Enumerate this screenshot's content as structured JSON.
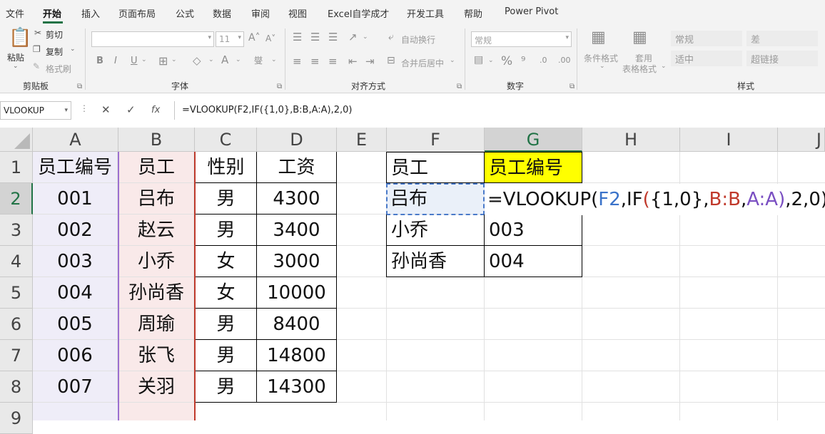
{
  "menu": {
    "tabs": [
      "文件",
      "开始",
      "插入",
      "页面布局",
      "公式",
      "数据",
      "审阅",
      "视图",
      "Excel自学成才",
      "开发工具",
      "帮助",
      "Power Pivot"
    ],
    "active": "开始"
  },
  "ribbon": {
    "clipboard": {
      "paste": "粘贴",
      "cut": "剪切",
      "copy": "复制",
      "format_painter": "格式刷",
      "label": "剪贴板"
    },
    "font": {
      "size": "11",
      "label": "字体",
      "bold": "B",
      "italic": "I",
      "underline": "U"
    },
    "alignment": {
      "wrap": "自动换行",
      "merge": "合并后居中",
      "label": "对齐方式"
    },
    "number": {
      "format": "常规",
      "label": "数字",
      "percent": "%"
    },
    "styles": {
      "conditional": "条件格式",
      "table_line1": "套用",
      "table_line2": "表格格式",
      "cells": [
        "常规",
        "差",
        "适中",
        "超链接"
      ],
      "label": "样式"
    }
  },
  "formula_bar": {
    "name_box": "VLOOKUP",
    "formula": "=VLOOKUP(F2,IF({1,0},B:B,A:A),2,0)"
  },
  "grid": {
    "columns": [
      "A",
      "B",
      "C",
      "D",
      "E",
      "F",
      "G",
      "H",
      "I",
      "J"
    ],
    "rows": [
      "1",
      "2",
      "3",
      "4",
      "5",
      "6",
      "7",
      "8",
      "9"
    ],
    "table": [
      [
        "员工编号",
        "员工",
        "性别",
        "工资"
      ],
      [
        "001",
        "吕布",
        "男",
        "4300"
      ],
      [
        "002",
        "赵云",
        "男",
        "3400"
      ],
      [
        "003",
        "小乔",
        "女",
        "3000"
      ],
      [
        "004",
        "孙尚香",
        "女",
        "10000"
      ],
      [
        "005",
        "周瑜",
        "男",
        "8400"
      ],
      [
        "006",
        "张飞",
        "男",
        "14800"
      ],
      [
        "007",
        "关羽",
        "男",
        "14300"
      ]
    ],
    "lookup": {
      "header_f": "员工",
      "header_g": "员工编号",
      "rows": [
        {
          "name": "吕布",
          "value": ""
        },
        {
          "name": "小乔",
          "value": "003"
        },
        {
          "name": "孙尚香",
          "value": "004"
        }
      ]
    },
    "edit": {
      "p1": "=VLOOKUP(",
      "ref_f2": "F2",
      "p2": ",IF",
      "open2": "(",
      "p3": "{1,0},",
      "ref_b": "B:B",
      "comma": ",",
      "ref_a": "A:A",
      "close2": ")",
      "p4": ",2,0)"
    }
  },
  "colors": {
    "accent": "#217346",
    "highlight_yellow": "#ffff00"
  }
}
